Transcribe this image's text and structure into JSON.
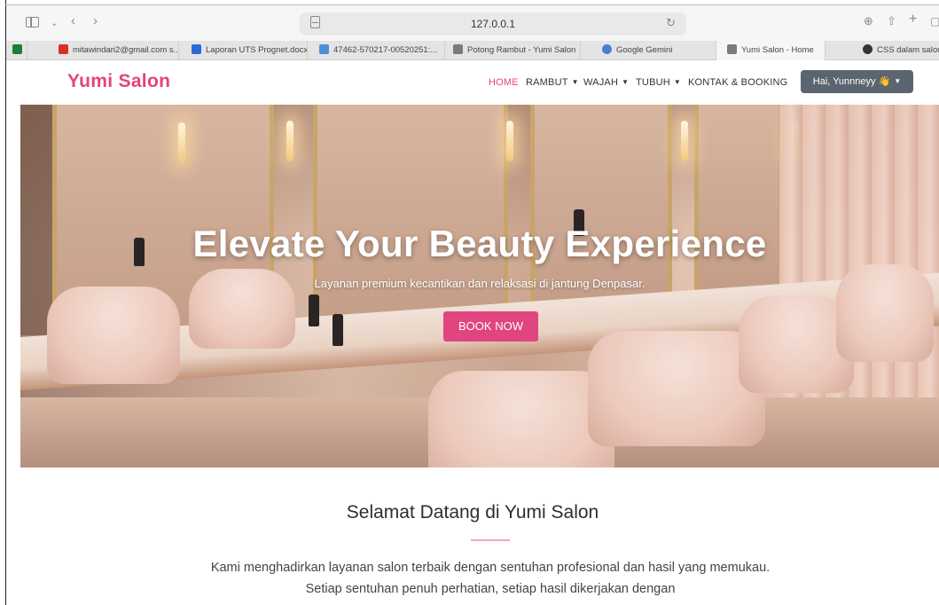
{
  "browser": {
    "url": "127.0.0.1",
    "tabs": [
      {
        "label": "mitawindari2@gmail.com s...",
        "icon": "gmail-icon",
        "color": "#d93025"
      },
      {
        "label": "Laporan UTS Prognet.docx",
        "icon": "word-icon",
        "color": "#2b6cd4"
      },
      {
        "label": "47462-570217-00520251:...",
        "icon": "drive-icon",
        "color": "#4a90d9"
      },
      {
        "label": "Potong Rambut - Yumi Salon",
        "icon": "site-icon",
        "color": "#7a7a7a"
      },
      {
        "label": "Google Gemini",
        "icon": "gemini-icon",
        "color": "#4a7bd9"
      },
      {
        "label": "Yumi Salon - Home",
        "icon": "site-icon",
        "color": "#7a7a7a"
      },
      {
        "label": "CSS dalam salon",
        "icon": "chatgpt-icon",
        "color": "#333333"
      }
    ]
  },
  "site": {
    "brand": "Yumi Salon",
    "accent": "#e0457f",
    "nav": {
      "home": "HOME",
      "rambut": "RAMBUT",
      "wajah": "WAJAH",
      "tubuh": "TUBUH",
      "kontak": "KONTAK & BOOKING"
    },
    "user_menu": "Hai, Yunnneyy 👋"
  },
  "hero": {
    "title": "Elevate Your Beauty Experience",
    "subtitle": "Layanan premium kecantikan dan relaksasi di jantung Denpasar.",
    "cta": "BOOK NOW"
  },
  "welcome": {
    "title": "Selamat Datang di Yumi Salon",
    "text": "Kami menghadirkan layanan salon terbaik dengan sentuhan profesional dan hasil yang memukau. Setiap sentuhan penuh perhatian, setiap hasil dikerjakan dengan"
  }
}
